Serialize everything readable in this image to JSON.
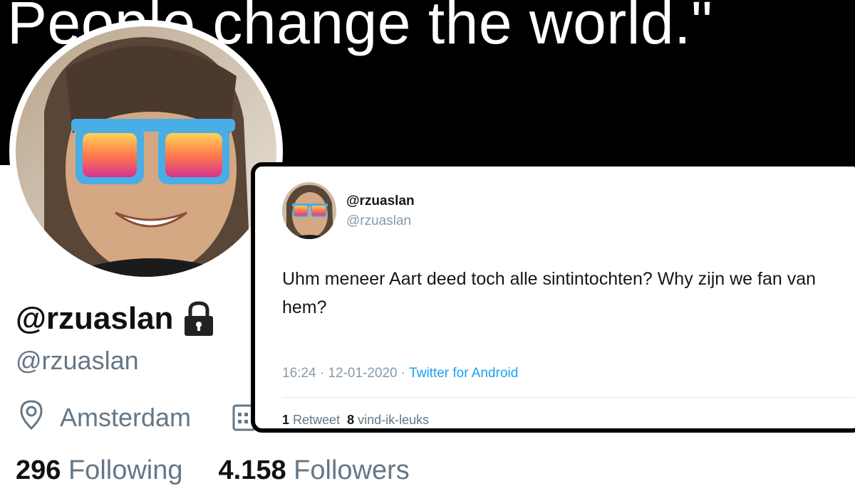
{
  "banner": {
    "quote": "People change the world.\""
  },
  "profile": {
    "display_name": "@rzuaslan",
    "handle": "@rzuaslan",
    "location": "Amsterdam",
    "following_count": "296",
    "following_label": "Following",
    "followers_count": "4.158",
    "followers_label": "Followers",
    "icons": {
      "lock": "lock-icon",
      "location": "pin-icon",
      "joined": "calendar-icon"
    }
  },
  "tweet": {
    "display_name": "@rzuaslan",
    "handle": "@rzuaslan",
    "text": "Uhm meneer Aart deed toch alle sintintochten? Why zijn we fan van hem?",
    "time": "16:24 · 12-01-2020 · ",
    "source": "Twitter for Android",
    "retweet_count": "1",
    "retweet_label": "Retweet",
    "likes_count": "8",
    "likes_label": "vind-ik-leuks"
  },
  "colors": {
    "banner_bg": "#000000",
    "secondary_text": "#657786",
    "link_blue": "#1da1f2",
    "divider": "#e1e8ed"
  }
}
